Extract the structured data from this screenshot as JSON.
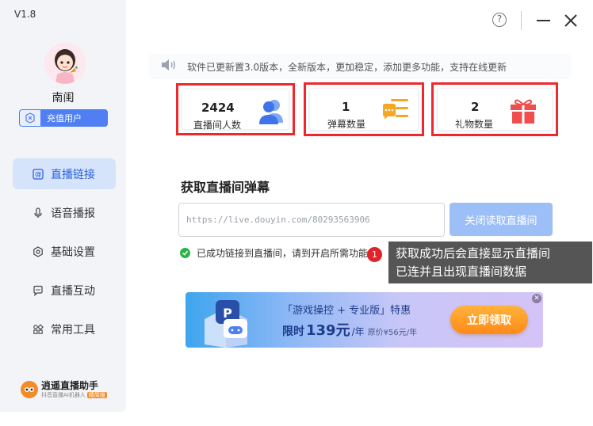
{
  "app": {
    "version": "V1.8"
  },
  "user": {
    "name": "南闺",
    "badge": "充值用户"
  },
  "sidebar": {
    "items": [
      {
        "label": "直播链接",
        "icon": "bullet-comment-icon",
        "active": true
      },
      {
        "label": "语音播报",
        "icon": "microphone-icon",
        "active": false
      },
      {
        "label": "基础设置",
        "icon": "gear-icon",
        "active": false
      },
      {
        "label": "直播互动",
        "icon": "chat-bubble-icon",
        "active": false
      },
      {
        "label": "常用工具",
        "icon": "grid-icon",
        "active": false
      }
    ],
    "brand": {
      "name": "逍遥直播助手",
      "sub": "抖音直播AI机器人",
      "tag": "精简版"
    }
  },
  "notice": {
    "text": "软件已更新置3.0版本，全新版本，更加稳定，添加更多功能，支持在线更新"
  },
  "stats": [
    {
      "value": "2424",
      "label": "直播间人数",
      "icon": "users-icon"
    },
    {
      "value": "1",
      "label": "弹幕数量",
      "icon": "comment-list-icon"
    },
    {
      "value": "2",
      "label": "礼物数量",
      "icon": "gift-icon"
    }
  ],
  "main": {
    "section_title": "获取直播间弹幕",
    "url_placeholder": "https://live.douyin.com/80293563906",
    "stop_button": "关闭读取直播间",
    "status_text": "已成功链接到直播间，请到开启所需功能",
    "step_number": "1",
    "tooltip_line1": "获取成功后会直接显示直播间",
    "tooltip_line2": "已连并且出现直播间数据"
  },
  "banner": {
    "line1": "「游戏操控 + 专业版」特惠",
    "price_prefix": "限时",
    "price": "139元",
    "unit": "/年",
    "original": "原价¥56元/年",
    "button": "立即领取"
  },
  "colors": {
    "accent": "#4f7ff3",
    "highlight": "#f0272d",
    "success": "#2bb34a"
  }
}
